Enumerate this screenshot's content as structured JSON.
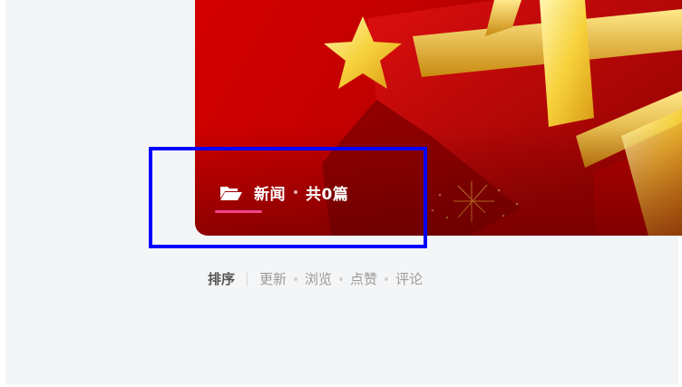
{
  "category": {
    "icon": "folder-open-icon",
    "name": "新闻",
    "count_text": "共0篇"
  },
  "sort": {
    "title": "排序",
    "options": [
      "更新",
      "浏览",
      "点赞",
      "评论"
    ]
  },
  "colors": {
    "background": "#f4f5f7",
    "banner_red": "#c30000",
    "accent_pink": "#f0448a",
    "highlight_blue": "#0000ff"
  }
}
